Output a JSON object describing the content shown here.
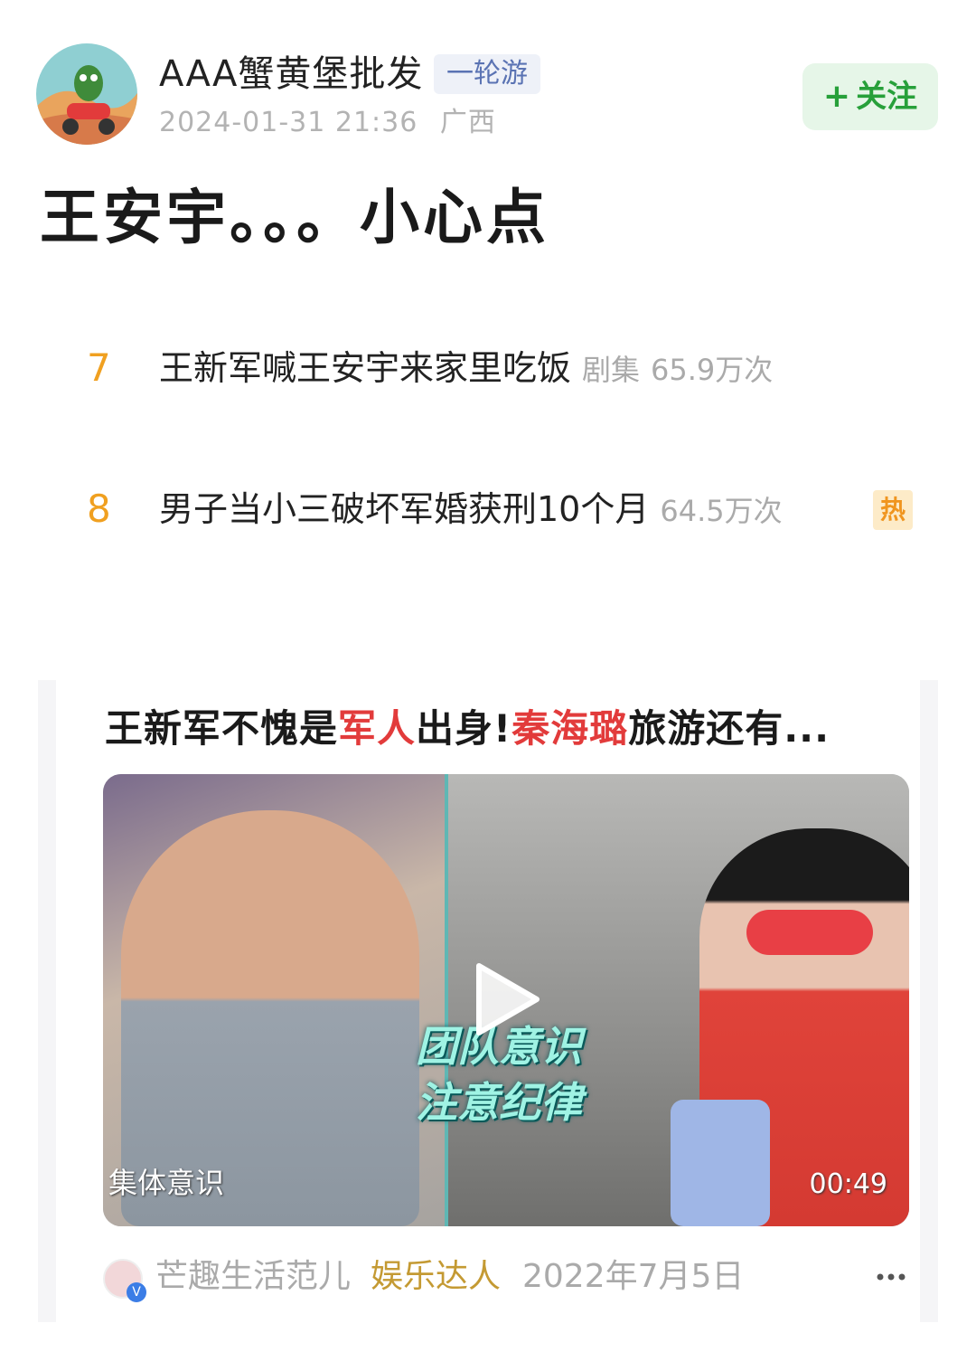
{
  "author": {
    "name": "AAA蟹黄堡批发",
    "tag": "一轮游",
    "datetime": "2024-01-31 21:36",
    "location": "广西",
    "follow_label": "关注",
    "follow_plus": "+"
  },
  "post": {
    "title": "王安宇。。。小心点"
  },
  "hot_list": [
    {
      "rank": "7",
      "text": "王新军喊王安宇来家里吃饭",
      "tag": "剧集",
      "count": "65.9万次",
      "badge": ""
    },
    {
      "rank": "8",
      "text": "男子当小三破坏军婚获刑10个月",
      "tag": "",
      "count": "64.5万次",
      "badge": "热"
    }
  ],
  "card": {
    "title_parts": [
      "王新军不愧是",
      "军人",
      "出身!",
      "秦海璐",
      "旅游还有..."
    ],
    "video": {
      "caption_line1": "团队意识",
      "caption_line2": "注意纪律",
      "subtitle_left": "集体意识",
      "duration": "00:49"
    },
    "footer": {
      "name": "芒趣生活范儿",
      "role": "娱乐达人",
      "date": "2022年7月5日",
      "verified": "V"
    }
  },
  "colors": {
    "accent_green": "#27a03a",
    "rank_orange": "#f0a020",
    "highlight_red": "#e23b3b",
    "role_gold": "#c49a33"
  },
  "icons": [
    "avatar-image",
    "play-icon",
    "more-icon",
    "verified-icon"
  ]
}
